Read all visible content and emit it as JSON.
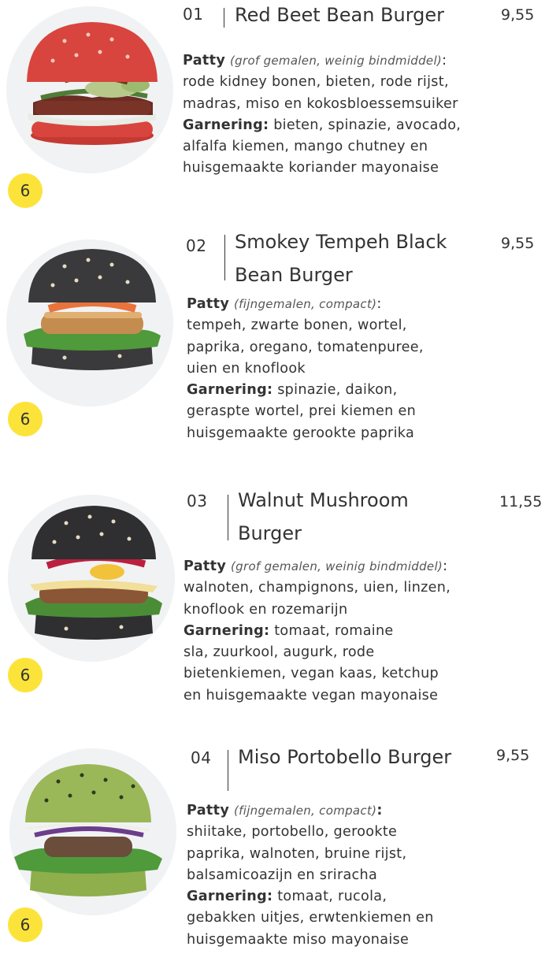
{
  "items": [
    {
      "number": "01",
      "name": "Red Beet Bean Burger",
      "price": "9,55",
      "badge": "6",
      "patty_label": "Patty",
      "patty_note": "(grof gemalen, weinig bindmiddel)",
      "patty_colon": ":",
      "patty_lines": [
        "rode kidney bonen, bieten, rode rijst,",
        "madras, miso en kokosbloessemsuiker"
      ],
      "garnish_label": "Garnering:",
      "garnish_first": " bieten, spinazie, avocado,",
      "garnish_lines": [
        "alfalfa kiemen, mango chutney en",
        "huisgemaakte koriander mayonaise"
      ],
      "bun_color": "#d8453e",
      "icon": "red-beet-burger-photo"
    },
    {
      "number": "02",
      "name_lines": [
        "Smokey Tempeh Black",
        "Bean Burger"
      ],
      "price": "9,55",
      "badge": "6",
      "patty_label": "Patty",
      "patty_note": "(fijngemalen, compact)",
      "patty_colon": ":",
      "patty_lines": [
        "tempeh, zwarte bonen, wortel,",
        "paprika, oregano, tomatenpuree,",
        "uien en knoflook"
      ],
      "garnish_label": "Garnering:",
      "garnish_first": " spinazie, daikon,",
      "garnish_lines": [
        "geraspte wortel, prei kiemen en",
        "huisgemaakte gerookte paprika"
      ],
      "bun_color": "#3a3a3c",
      "icon": "tempeh-black-burger-photo"
    },
    {
      "number": "03",
      "name_lines": [
        "Walnut Mushroom",
        "Burger"
      ],
      "price": "11,55",
      "badge": "6",
      "patty_label": "Patty",
      "patty_note": "(grof gemalen, weinig bindmiddel)",
      "patty_colon": ":",
      "patty_lines": [
        "walnoten, champignons, uien, linzen,",
        "knoflook en rozemarijn"
      ],
      "garnish_label": "Garnering:",
      "garnish_first": " tomaat, romaine",
      "garnish_lines": [
        "sla, zuurkool, augurk, rode",
        "bietenkiemen, vegan kaas, ketchup",
        "en huisgemaakte vegan mayonaise"
      ],
      "bun_color": "#2f2f31",
      "icon": "walnut-mushroom-burger-photo"
    },
    {
      "number": "04",
      "name": "Miso Portobello Burger",
      "price": "9,55",
      "badge": "6",
      "patty_label": "Patty",
      "patty_note": "(fijngemalen, compact)",
      "patty_colon": ":",
      "patty_lines": [
        "shiitake, portobello, gerookte",
        "paprika, walnoten, bruine rijst,",
        "balsamicoazijn en sriracha"
      ],
      "garnish_label": "Garnering:",
      "garnish_first": " tomaat, rucola,",
      "garnish_lines": [
        "gebakken uitjes, erwtenkiemen en",
        "huisgemaakte miso mayonaise"
      ],
      "bun_color": "#8fae4c",
      "icon": "miso-portobello-burger-photo"
    }
  ]
}
